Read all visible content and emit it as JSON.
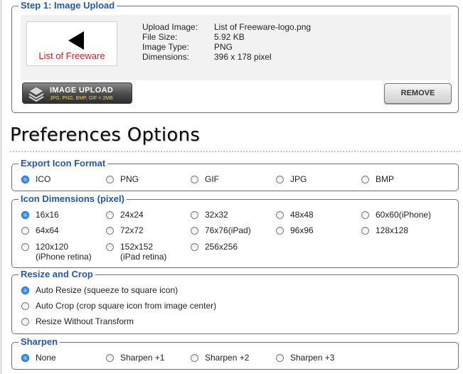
{
  "upload": {
    "legend": "Step 1: Image Upload",
    "logo_text": "List of Freeware",
    "labels": [
      "Upload Image:",
      "File Size:",
      "Image Type:",
      "Dimensions:"
    ],
    "values": [
      "List of Freeware-logo.png",
      "5.92 KB",
      "PNG",
      "396 x 178 pixel"
    ],
    "image_upload_button": "IMAGE UPLOAD",
    "image_upload_sub": "JPG, PNG, BMP, GIF  < 2MB",
    "remove_button": "REMOVE"
  },
  "preferences_title": "Preferences Options",
  "export_format": {
    "legend": "Export Icon Format",
    "options": [
      "ICO",
      "PNG",
      "GIF",
      "JPG",
      "BMP"
    ],
    "selected": "ICO"
  },
  "dimensions": {
    "legend": "Icon Dimensions (pixel)",
    "options": [
      {
        "l1": "16x16",
        "l2": ""
      },
      {
        "l1": "24x24",
        "l2": ""
      },
      {
        "l1": "32x32",
        "l2": ""
      },
      {
        "l1": "48x48",
        "l2": ""
      },
      {
        "l1": "60x60(iPhone)",
        "l2": ""
      },
      {
        "l1": "64x64",
        "l2": ""
      },
      {
        "l1": "72x72",
        "l2": ""
      },
      {
        "l1": "76x76(iPad)",
        "l2": ""
      },
      {
        "l1": "96x96",
        "l2": ""
      },
      {
        "l1": "128x128",
        "l2": ""
      },
      {
        "l1": "120x120",
        "l2": "(iPhone retina)"
      },
      {
        "l1": "152x152",
        "l2": "(iPad retina)"
      },
      {
        "l1": "256x256",
        "l2": ""
      }
    ],
    "selected": "16x16"
  },
  "resize": {
    "legend": "Resize and Crop",
    "options": [
      "Auto Resize (squeeze to square icon)",
      "Auto Crop (crop square icon from image center)",
      "Resize Without Transform"
    ],
    "selected": "Auto Resize (squeeze to square icon)"
  },
  "sharpen": {
    "legend": "Sharpen",
    "options": [
      "None",
      "Sharpen +1",
      "Sharpen +2",
      "Sharpen +3"
    ],
    "selected": "None"
  },
  "colors": {
    "legend_blue": "#1f58ad",
    "logo_red": "#d11f1f",
    "radio_selected": "#3b8de0"
  }
}
